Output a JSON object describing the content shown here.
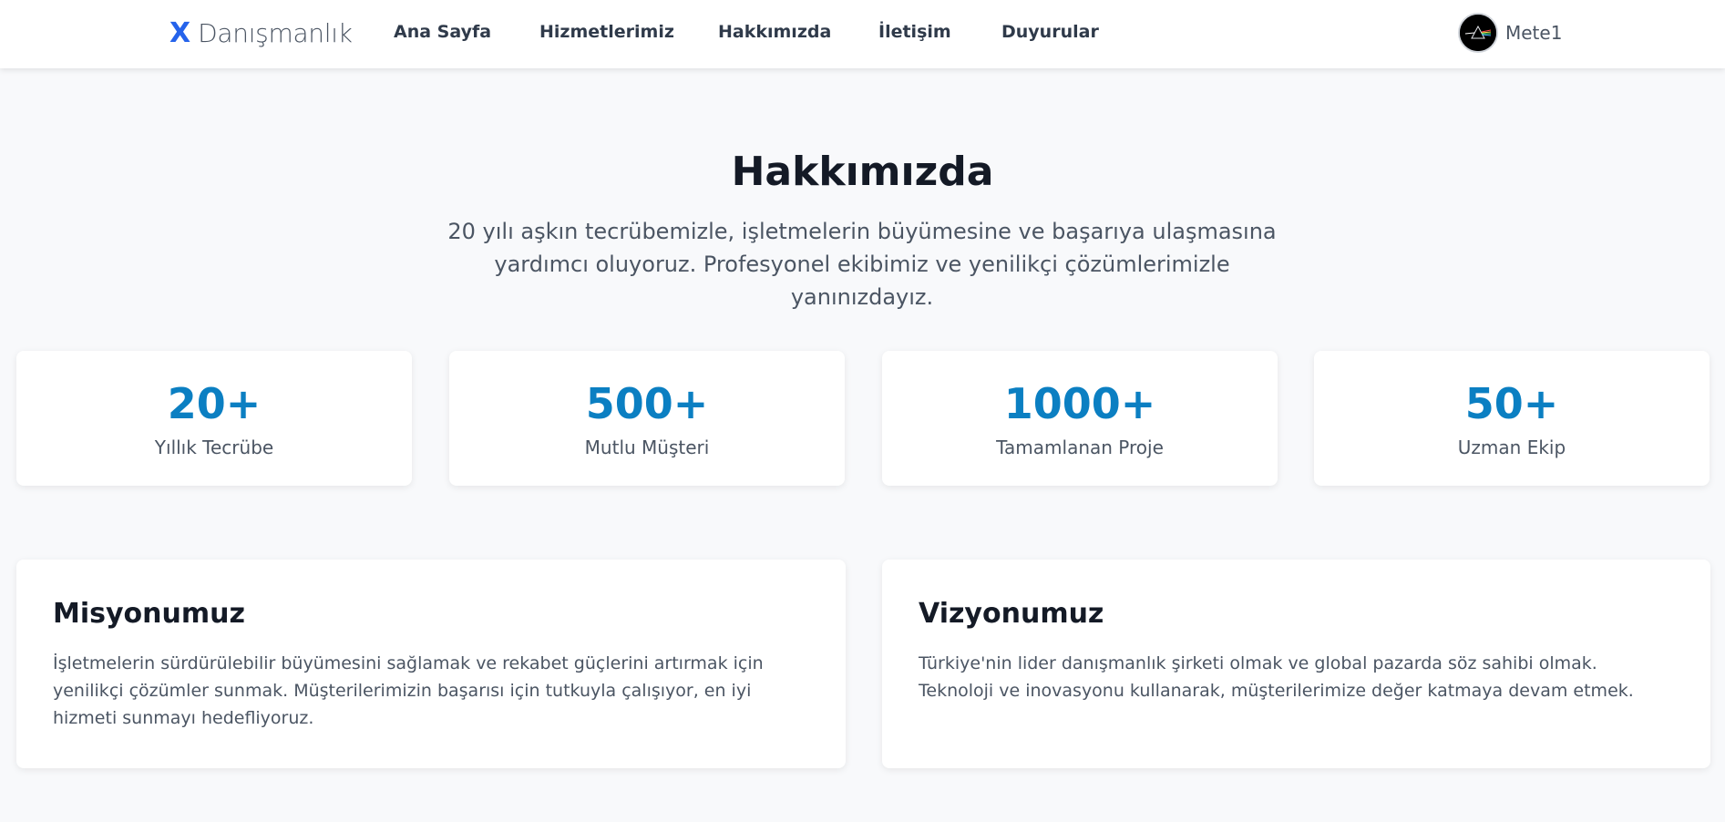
{
  "header": {
    "brand_mark": "X",
    "brand_name": "Danışmanlık",
    "nav": [
      {
        "label": "Ana Sayfa"
      },
      {
        "label": "Hizmetlerimiz"
      },
      {
        "label": "Hakkımızda"
      },
      {
        "label": "İletişim"
      },
      {
        "label": "Duyurular"
      }
    ],
    "user": {
      "name": "Mete1",
      "avatar_icon": "avatar-image"
    }
  },
  "hero": {
    "title": "Hakkımızda",
    "subtitle": "20 yılı aşkın tecrübemizle, işletmelerin büyümesine ve başarıya ulaşmasına yardımcı oluyoruz. Profesyonel ekibimiz ve yenilikçi çözümlerimizle yanınızdayız."
  },
  "stats": [
    {
      "value": "20+",
      "label": "Yıllık Tecrübe"
    },
    {
      "value": "500+",
      "label": "Mutlu Müşteri"
    },
    {
      "value": "1000+",
      "label": "Tamamlanan Proje"
    },
    {
      "value": "50+",
      "label": "Uzman Ekip"
    }
  ],
  "mission": {
    "title": "Misyonumuz",
    "text": "İşletmelerin sürdürülebilir büyümesini sağlamak ve rekabet güçlerini artırmak için yenilikçi çözümler sunmak. Müşterilerimizin başarısı için tutkuyla çalışıyor, en iyi hizmeti sunmayı hedefliyoruz."
  },
  "vision": {
    "title": "Vizyonumuz",
    "text": "Türkiye'nin lider danışmanlık şirketi olmak ve global pazarda söz sahibi olmak. Teknoloji ve inovasyonu kullanarak, müşterilerimize değer katmaya devam etmek."
  },
  "colors": {
    "brand_accent": "#2563eb",
    "stat_value": "#0b7fc2",
    "page_bg": "#f8f9fb"
  }
}
